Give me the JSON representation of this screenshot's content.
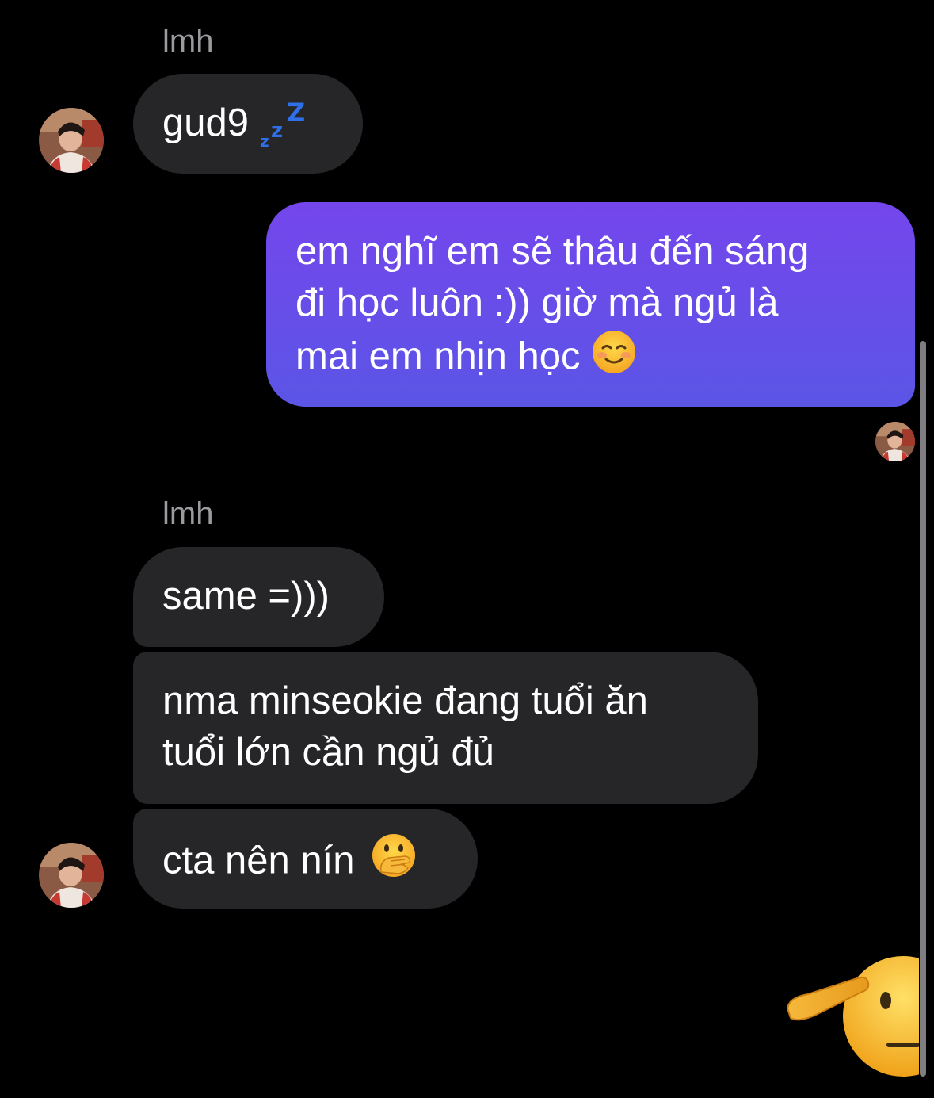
{
  "chat": {
    "groups": [
      {
        "sender": "lmh",
        "messages": [
          "gud9"
        ]
      },
      {
        "outgoing": {
          "line1": "em nghĩ em sẽ thâu đến sáng",
          "line2": "đi học luôn :)) giờ mà ngủ là",
          "line3": "mai em nhịn học"
        }
      },
      {
        "sender": "lmh",
        "messages": [
          "same =)))",
          {
            "line1": "nma minseokie đang tuổi ăn",
            "line2": "tuổi lớn cần ngủ đủ"
          },
          "cta nên nín"
        ]
      }
    ]
  },
  "icons": {
    "zzz": "zzz-emoji",
    "smiling_face": "smiling-face-emoji",
    "hand_over_mouth": "face-with-hand-over-mouth-emoji",
    "salute": "saluting-face-emoji",
    "avatar": "contact-avatar"
  },
  "colors": {
    "background": "#000000",
    "incoming_bubble": "#262628",
    "outgoing_gradient_top": "#7446ec",
    "outgoing_gradient_bottom": "#5b55e6",
    "sender_name": "#9a9a9f"
  }
}
